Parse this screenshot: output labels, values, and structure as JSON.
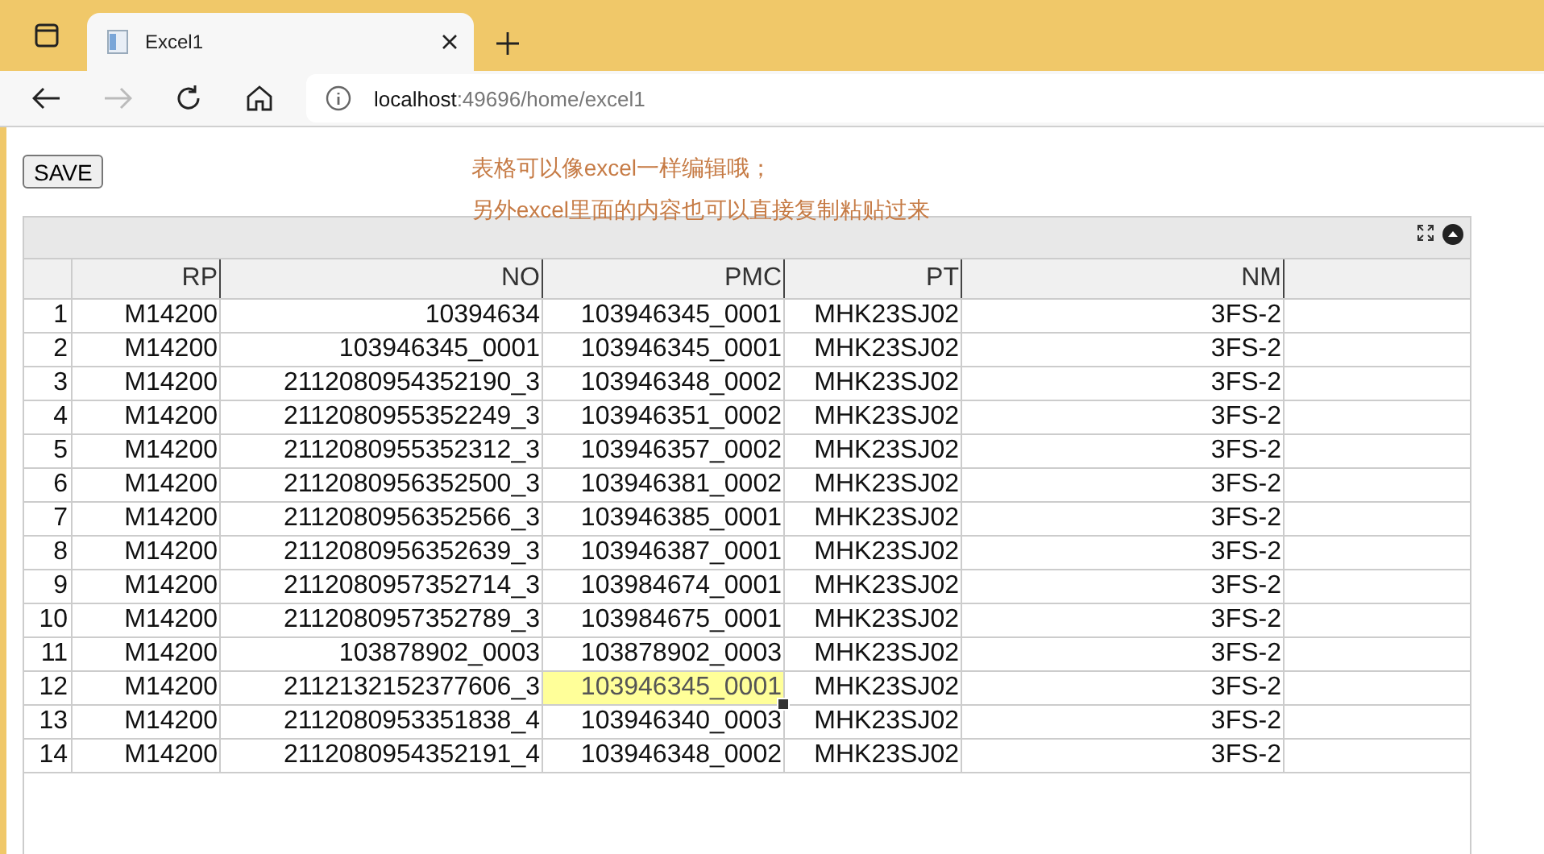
{
  "browser": {
    "tab": {
      "title": "Excel1",
      "selected": true
    },
    "nav": {
      "back_disabled": false,
      "forward_disabled": true
    },
    "address": {
      "host": "localhost",
      "path": ":49696/home/excel1"
    }
  },
  "page": {
    "save_button": "SAVE",
    "notes": [
      "表格可以像excel一样编辑哦；",
      "另外excel里面的内容也可以直接复制粘贴过来"
    ]
  },
  "grid": {
    "columns": [
      "RP",
      "NO",
      "PMC",
      "PT",
      "NM"
    ],
    "rows": [
      {
        "number": "1",
        "cells": [
          {
            "text": "M14200",
            "selected": false
          },
          {
            "text": "10394634",
            "selected": false
          },
          {
            "text": "103946345_0001",
            "selected": false
          },
          {
            "text": "MHK23SJ02",
            "selected": false
          },
          {
            "text": "3FS-2",
            "selected": false
          }
        ]
      },
      {
        "number": "2",
        "cells": [
          {
            "text": "M14200",
            "selected": false
          },
          {
            "text": "103946345_0001",
            "selected": false
          },
          {
            "text": "103946345_0001",
            "selected": false
          },
          {
            "text": "MHK23SJ02",
            "selected": false
          },
          {
            "text": "3FS-2",
            "selected": false
          }
        ]
      },
      {
        "number": "3",
        "cells": [
          {
            "text": "M14200",
            "selected": false
          },
          {
            "text": "2112080954352190_3",
            "selected": false
          },
          {
            "text": "103946348_0002",
            "selected": false
          },
          {
            "text": "MHK23SJ02",
            "selected": false
          },
          {
            "text": "3FS-2",
            "selected": false
          }
        ]
      },
      {
        "number": "4",
        "cells": [
          {
            "text": "M14200",
            "selected": false
          },
          {
            "text": "2112080955352249_3",
            "selected": false
          },
          {
            "text": "103946351_0002",
            "selected": false
          },
          {
            "text": "MHK23SJ02",
            "selected": false
          },
          {
            "text": "3FS-2",
            "selected": false
          }
        ]
      },
      {
        "number": "5",
        "cells": [
          {
            "text": "M14200",
            "selected": false
          },
          {
            "text": "2112080955352312_3",
            "selected": false
          },
          {
            "text": "103946357_0002",
            "selected": false
          },
          {
            "text": "MHK23SJ02",
            "selected": false
          },
          {
            "text": "3FS-2",
            "selected": false
          }
        ]
      },
      {
        "number": "6",
        "cells": [
          {
            "text": "M14200",
            "selected": false
          },
          {
            "text": "2112080956352500_3",
            "selected": false
          },
          {
            "text": "103946381_0002",
            "selected": false
          },
          {
            "text": "MHK23SJ02",
            "selected": false
          },
          {
            "text": "3FS-2",
            "selected": false
          }
        ]
      },
      {
        "number": "7",
        "cells": [
          {
            "text": "M14200",
            "selected": false
          },
          {
            "text": "2112080956352566_3",
            "selected": false
          },
          {
            "text": "103946385_0001",
            "selected": false
          },
          {
            "text": "MHK23SJ02",
            "selected": false
          },
          {
            "text": "3FS-2",
            "selected": false
          }
        ]
      },
      {
        "number": "8",
        "cells": [
          {
            "text": "M14200",
            "selected": false
          },
          {
            "text": "2112080956352639_3",
            "selected": false
          },
          {
            "text": "103946387_0001",
            "selected": false
          },
          {
            "text": "MHK23SJ02",
            "selected": false
          },
          {
            "text": "3FS-2",
            "selected": false
          }
        ]
      },
      {
        "number": "9",
        "cells": [
          {
            "text": "M14200",
            "selected": false
          },
          {
            "text": "2112080957352714_3",
            "selected": false
          },
          {
            "text": "103984674_0001",
            "selected": false
          },
          {
            "text": "MHK23SJ02",
            "selected": false
          },
          {
            "text": "3FS-2",
            "selected": false
          }
        ]
      },
      {
        "number": "10",
        "cells": [
          {
            "text": "M14200",
            "selected": false
          },
          {
            "text": "2112080957352789_3",
            "selected": false
          },
          {
            "text": "103984675_0001",
            "selected": false
          },
          {
            "text": "MHK23SJ02",
            "selected": false
          },
          {
            "text": "3FS-2",
            "selected": false
          }
        ]
      },
      {
        "number": "11",
        "cells": [
          {
            "text": "M14200",
            "selected": false
          },
          {
            "text": "103878902_0003",
            "selected": false
          },
          {
            "text": "103878902_0003",
            "selected": false
          },
          {
            "text": "MHK23SJ02",
            "selected": false
          },
          {
            "text": "3FS-2",
            "selected": false
          }
        ]
      },
      {
        "number": "12",
        "cells": [
          {
            "text": "M14200",
            "selected": false
          },
          {
            "text": "2112132152377606_3",
            "selected": false
          },
          {
            "text": "103946345_0001",
            "selected": true
          },
          {
            "text": "MHK23SJ02",
            "selected": false
          },
          {
            "text": "3FS-2",
            "selected": false
          }
        ]
      },
      {
        "number": "13",
        "cells": [
          {
            "text": "M14200",
            "selected": false
          },
          {
            "text": "2112080953351838_4",
            "selected": false
          },
          {
            "text": "103946340_0003",
            "selected": false
          },
          {
            "text": "MHK23SJ02",
            "selected": false
          },
          {
            "text": "3FS-2",
            "selected": false
          }
        ]
      },
      {
        "number": "14",
        "cells": [
          {
            "text": "M14200",
            "selected": false
          },
          {
            "text": "2112080954352191_4",
            "selected": false
          },
          {
            "text": "103946348_0002",
            "selected": false
          },
          {
            "text": "MHK23SJ02",
            "selected": false
          },
          {
            "text": "3FS-2",
            "selected": false
          }
        ]
      }
    ]
  }
}
